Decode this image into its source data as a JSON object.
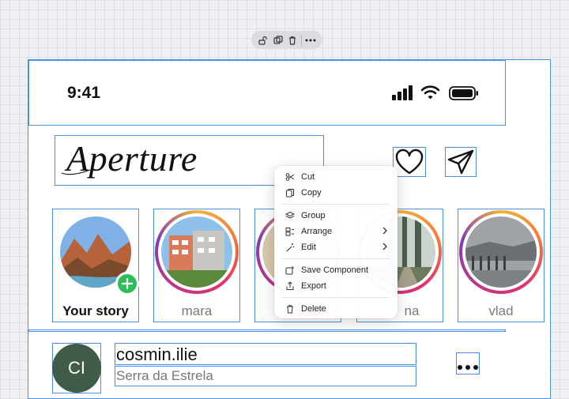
{
  "toolbar": {
    "icons": [
      "lock-open-icon",
      "duplicate-icon",
      "trash-icon",
      "more-icon"
    ]
  },
  "status_bar": {
    "time": "9:41",
    "icons": [
      "signal-icon",
      "wifi-icon",
      "battery-icon"
    ]
  },
  "header": {
    "logo": "Aperture",
    "icons": [
      "heart-icon",
      "send-icon"
    ]
  },
  "stories": [
    {
      "name": "Your story",
      "own": true
    },
    {
      "name": "mara",
      "own": false
    },
    {
      "name": "",
      "own": false
    },
    {
      "name": "na",
      "own": false
    },
    {
      "name": "vlad",
      "own": false
    }
  ],
  "context_menu": {
    "items": [
      {
        "label": "Cut",
        "icon": "scissors-icon"
      },
      {
        "label": "Copy",
        "icon": "copy-icon"
      },
      {
        "label": "Group",
        "icon": "layers-icon"
      },
      {
        "label": "Arrange",
        "icon": "arrange-icon",
        "submenu": true
      },
      {
        "label": "Edit",
        "icon": "magic-wand-icon",
        "submenu": true
      },
      {
        "label": "Save Component",
        "icon": "save-component-icon"
      },
      {
        "label": "Export",
        "icon": "export-icon"
      },
      {
        "label": "Delete",
        "icon": "trash-icon"
      }
    ]
  },
  "post": {
    "avatar_initials": "CI",
    "username": "cosmin.ilie",
    "location": "Serra da Estrela"
  },
  "colors": {
    "selection": "#4a90e2",
    "add_story": "#2fbd5b",
    "avatar_bg": "#3f5c48"
  }
}
